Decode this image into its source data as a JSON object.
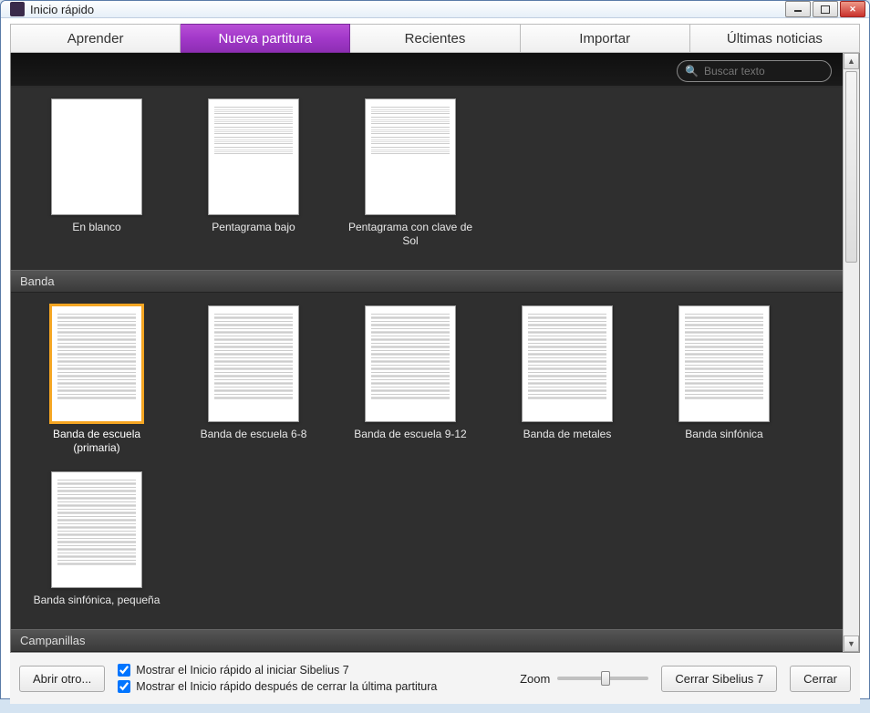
{
  "window": {
    "title": "Inicio rápido"
  },
  "tabs": [
    {
      "label": "Aprender"
    },
    {
      "label": "Nueva partitura"
    },
    {
      "label": "Recientes"
    },
    {
      "label": "Importar"
    },
    {
      "label": "Últimas noticias"
    }
  ],
  "active_tab_index": 1,
  "search": {
    "placeholder": "Buscar texto"
  },
  "sections": [
    {
      "name": "top",
      "header": null,
      "templates": [
        {
          "label": "En blanco",
          "style": "blank"
        },
        {
          "label": "Pentagrama bajo",
          "style": "few"
        },
        {
          "label": "Pentagrama con clave de Sol",
          "style": "few"
        }
      ]
    },
    {
      "name": "banda",
      "header": "Banda",
      "templates": [
        {
          "label": "Banda de escuela (primaria)",
          "style": "many",
          "selected": true
        },
        {
          "label": "Banda de escuela 6-8",
          "style": "many"
        },
        {
          "label": "Banda de escuela 9-12",
          "style": "many"
        },
        {
          "label": "Banda de metales",
          "style": "many"
        },
        {
          "label": "Banda sinfónica",
          "style": "many"
        },
        {
          "label": "Banda sinfónica, pequeña",
          "style": "many"
        }
      ]
    },
    {
      "name": "campanillas",
      "header": "Campanillas",
      "templates": []
    }
  ],
  "footer": {
    "open_other": "Abrir otro...",
    "check1": "Mostrar el Inicio rápido al iniciar Sibelius 7",
    "check2": "Mostrar el Inicio rápido después de cerrar la última partitura",
    "zoom_label": "Zoom",
    "close_app": "Cerrar Sibelius 7",
    "close": "Cerrar"
  }
}
